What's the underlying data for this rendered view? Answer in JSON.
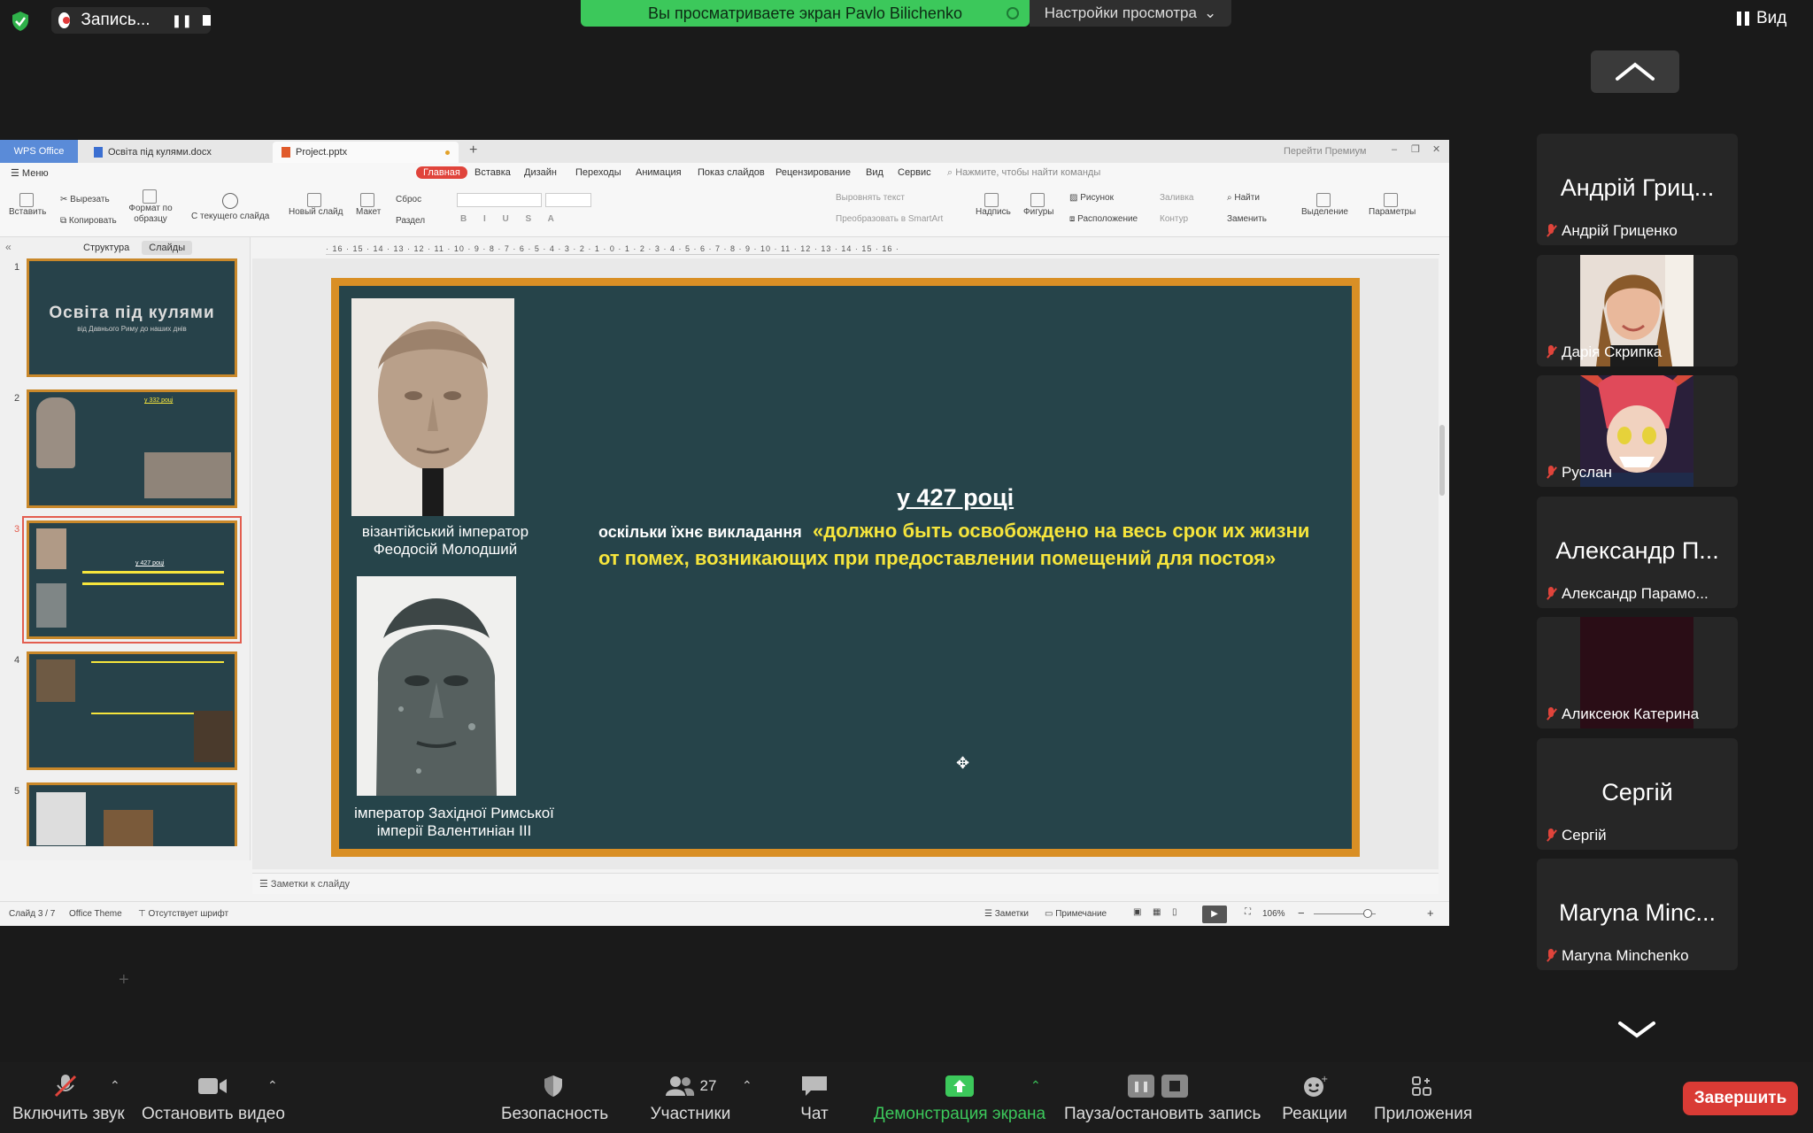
{
  "zoom_top": {
    "recording_label": "Запись...",
    "share_banner": "Вы просматриваете экран Pavlo Bilichenko",
    "view_settings": "Настройки просмотра",
    "view_button": "Вид"
  },
  "wps": {
    "tabs": {
      "brand": "WPS Office",
      "doc1": "Освіта під кулями.docx",
      "doc2": "Project.pptx",
      "premium": "Перейти Премиум"
    },
    "menu": {
      "main_menu": "Меню",
      "items": [
        "Главная",
        "Вставка",
        "Дизайн",
        "Переходы",
        "Анимация",
        "Показ слайдов",
        "Рецензирование",
        "Вид",
        "Сервис"
      ],
      "search_placeholder": "Нажмите, чтобы найти команды"
    },
    "ribbon": {
      "paste": "Вставить",
      "cut": "Вырезать",
      "copy": "Копировать",
      "format_painter": "Формат по образцу",
      "from_current": "С текущего слайда",
      "new_slide": "Новый слайд",
      "layout": "Макет",
      "reset": "Сброс",
      "section": "Раздел",
      "align_text": "Выровнять текст",
      "smartart": "Преобразовать в SmartArt",
      "caption": "Надпись",
      "shapes": "Фигуры",
      "picture": "Рисунок",
      "arrange": "Расположение",
      "fill": "Заливка",
      "outline": "Контур",
      "find": "Найти",
      "replace": "Заменить",
      "select": "Выделение",
      "params": "Параметры"
    },
    "ruler": "· 16 · 15 · 14 · 13 · 12 · 11 · 10 · 9 · 8 · 7 · 6 · 5 · 4 · 3 · 2 · 1 · 0 · 1 · 2 · 3 · 4 · 5 · 6 · 7 · 8 · 9 · 10 · 11 · 12 · 13 · 14 · 15 · 16 ·",
    "panel_tabs": [
      "Структура",
      "Слайды"
    ],
    "thumbs": [
      {
        "num": "1",
        "title": "Освіта під кулями",
        "sub": "від Давнього Риму до наших днів"
      },
      {
        "num": "2",
        "title": "у 332 році"
      },
      {
        "num": "3",
        "title": "у 427 році"
      },
      {
        "num": "4"
      },
      {
        "num": "5"
      }
    ],
    "slide": {
      "caption1": "візантійський імператор Феодосій Молодший",
      "caption2": "імператор Західної Римської імперії Валентиніан III",
      "title": "у 427 році",
      "body_white": "оскільки їхнє викладання",
      "body_yellow": "«должно быть освобождено на весь срок их жизни от помех, возникающих при предоставлении помещений для постоя»"
    },
    "notes_label": "Заметки к слайду",
    "status": {
      "slide_counter": "Слайд 3 / 7",
      "theme": "Office Theme",
      "missing_font": "Отсутствует шрифт",
      "notes": "Заметки",
      "comment": "Примечание",
      "zoom": "106%"
    }
  },
  "participants": [
    {
      "big": "Андрій Гриц...",
      "name": "Андрій Гриценко"
    },
    {
      "big": "",
      "name": "Дарія Скрипка",
      "photo": "girl-photo"
    },
    {
      "big": "",
      "name": "Руслан",
      "photo": "anime-avatar"
    },
    {
      "big": "Александр П...",
      "name": "Александр Парамо..."
    },
    {
      "big": "",
      "name": "Аликсеюк Катерина",
      "photo": "dark-video"
    },
    {
      "big": "Сергій",
      "name": "Сергій"
    },
    {
      "big": "Maryna Minc...",
      "name": "Maryna Minchenko"
    }
  ],
  "toolbar": {
    "unmute": "Включить звук",
    "stop_video": "Остановить видео",
    "security": "Безопасность",
    "participants": "Участники",
    "participants_count": "27",
    "chat": "Чат",
    "share": "Демонстрация экрана",
    "pause_record": "Пауза/остановить запись",
    "reactions": "Реакции",
    "apps": "Приложения",
    "end": "Завершить"
  },
  "colors": {
    "share_green": "#3cc85b",
    "slide_bg": "#26444a",
    "slide_border": "#d98f25",
    "quote_yellow": "#f6e53c",
    "end_red": "#d93b35"
  }
}
